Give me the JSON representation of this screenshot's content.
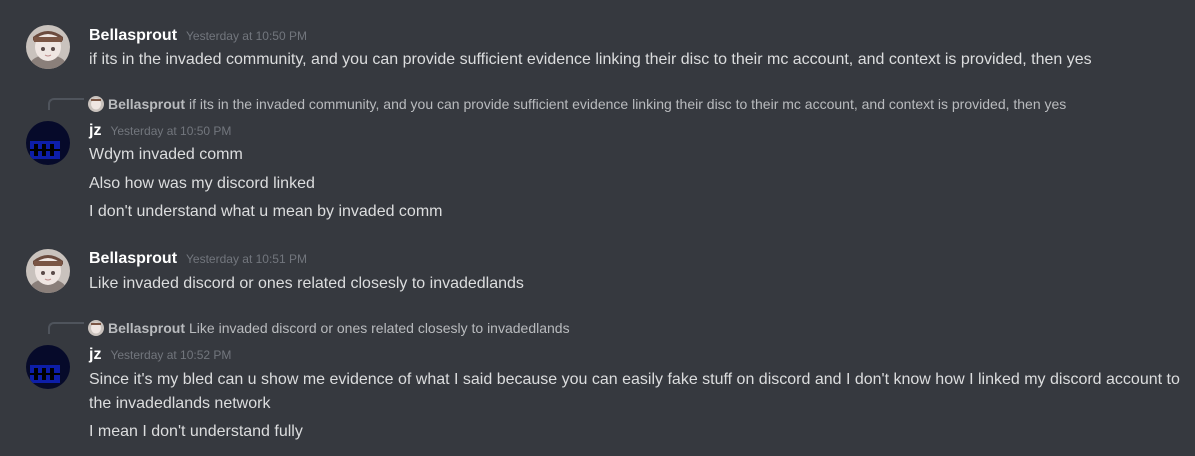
{
  "messages": [
    {
      "author": "Bellasprout",
      "timestamp": "Yesterday at 10:50 PM",
      "lines": [
        "if its in the invaded community, and you can provide sufficient evidence linking their disc to their mc account, and context is provided, then yes"
      ]
    },
    {
      "reply_to": {
        "author": "Bellasprout",
        "text": "if its in the invaded community, and you can provide sufficient evidence linking their disc to their mc account, and context is provided, then yes"
      },
      "author": "jz",
      "timestamp": "Yesterday at 10:50 PM",
      "lines": [
        "Wdym invaded comm",
        "Also how was my discord linked",
        "I don't understand what u mean by invaded comm"
      ]
    },
    {
      "author": "Bellasprout",
      "timestamp": "Yesterday at 10:51 PM",
      "lines": [
        "Like invaded discord or ones related closesly to invadedlands"
      ]
    },
    {
      "reply_to": {
        "author": "Bellasprout",
        "text": "Like invaded discord or ones related closesly to invadedlands"
      },
      "author": "jz",
      "timestamp": "Yesterday at 10:52 PM",
      "lines": [
        "Since it's my bled can u show me evidence of what I said because you can easily fake stuff on discord and I don't know how I linked my discord account to the invadedlands network",
        "I mean I don't understand fully"
      ]
    }
  ],
  "colors": {
    "background": "#36393f",
    "username": "#ffffff",
    "text": "#dcddde",
    "timestamp": "#72767d",
    "reply_text": "#b9bbbe"
  },
  "icons": {
    "bellasprout_avatar": "anime-avatar-icon",
    "jz_avatar": "dark-blue-avatar-icon"
  }
}
